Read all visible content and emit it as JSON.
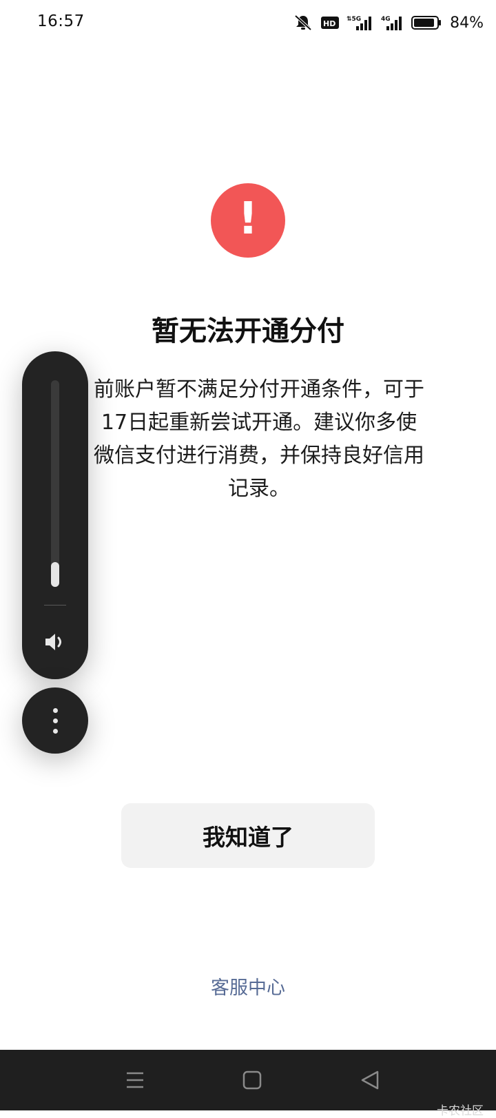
{
  "status_bar": {
    "time": "16:57",
    "battery": "84%",
    "icons": [
      "mute-bell-icon",
      "hd-icon",
      "signal-5g-icon",
      "signal-4g-icon",
      "battery-icon"
    ]
  },
  "dialog": {
    "icon": "exclamation-icon",
    "icon_glyph": "!",
    "title": "暂无法开通分付",
    "message_lines": [
      "前账户暂不满足分付开通条件，可于",
      "17日起重新尝试开通。建议你多使",
      "微信支付进行消费，并保持良好信用",
      "记录。"
    ],
    "confirm_label": "我知道了",
    "service_link": "客服中心",
    "accent_color": "#f25656",
    "link_color": "#576b95"
  },
  "volume_overlay": {
    "level": 0.12,
    "speaker_icon": "speaker-icon",
    "more_icon": "more-vertical-icon"
  },
  "nav_bar": {
    "items": [
      "menu-icon",
      "home-icon",
      "back-icon"
    ]
  },
  "watermark": "卡农社区"
}
